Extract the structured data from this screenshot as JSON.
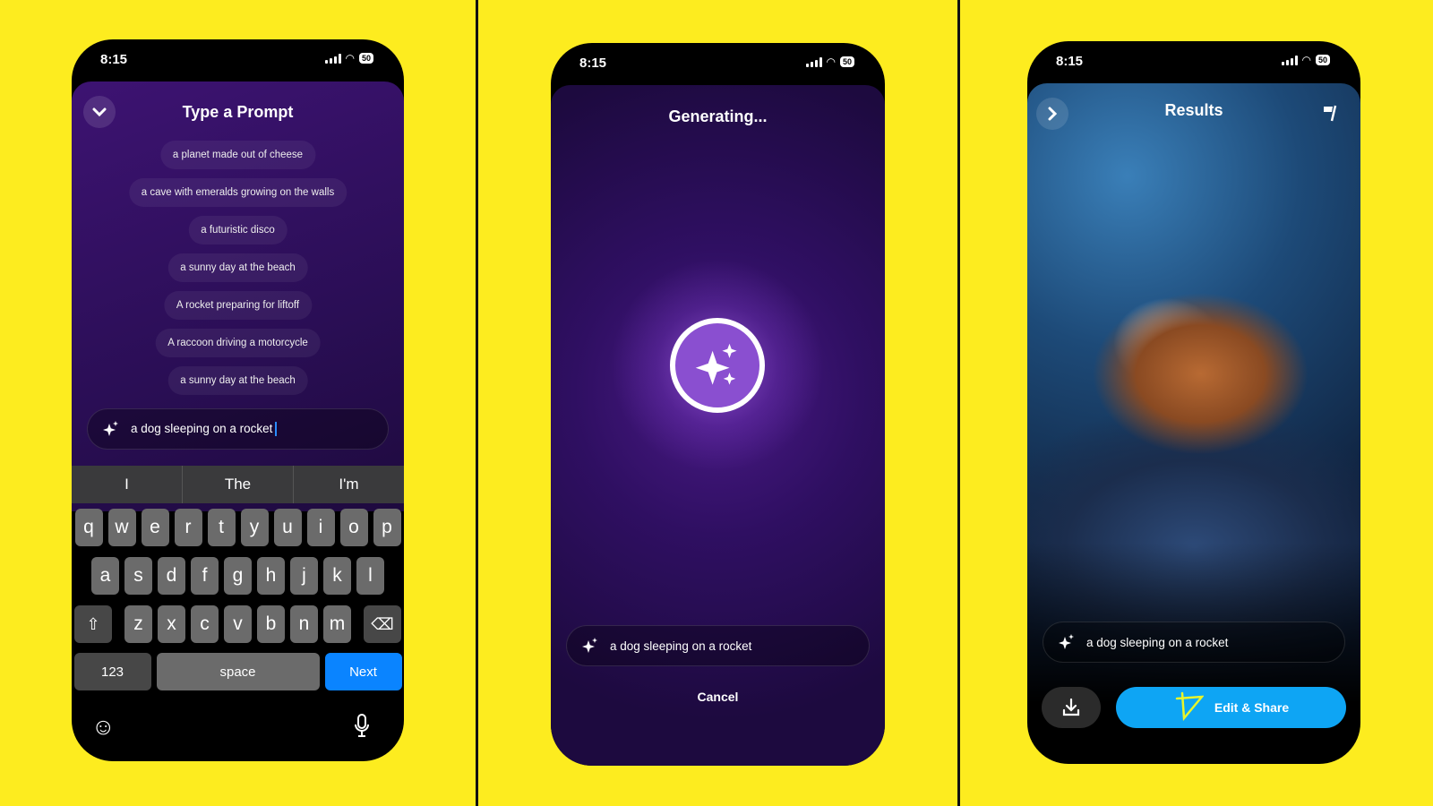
{
  "colors": {
    "background": "#fdec1f",
    "purple": "#2f0f62",
    "accent_blue": "#0ea5f4",
    "keyboard_next": "#0a84ff"
  },
  "status": {
    "time": "8:15",
    "battery": "50"
  },
  "screen1": {
    "title": "Type a Prompt",
    "collapse_icon": "chevron-down-icon",
    "suggestions": [
      "a planet made out of cheese",
      "a cave with emeralds growing on the walls",
      "a futuristic disco",
      "a sunny day at the beach",
      "A rocket preparing for liftoff",
      "A raccoon driving a motorcycle",
      "a sunny day at the beach"
    ],
    "input_value": "a dog sleeping on a rocket",
    "keyboard": {
      "predictions": [
        "I",
        "The",
        "I'm"
      ],
      "row1": [
        "q",
        "w",
        "e",
        "r",
        "t",
        "y",
        "u",
        "i",
        "o",
        "p"
      ],
      "row2": [
        "a",
        "s",
        "d",
        "f",
        "g",
        "h",
        "j",
        "k",
        "l"
      ],
      "row3": [
        "z",
        "x",
        "c",
        "v",
        "b",
        "n",
        "m"
      ],
      "numbers_label": "123",
      "space_label": "space",
      "next_label": "Next"
    }
  },
  "screen2": {
    "title": "Generating...",
    "input_value": "a dog sleeping on a rocket",
    "cancel_label": "Cancel"
  },
  "screen3": {
    "title": "Results",
    "input_value": "a dog sleeping on a rocket",
    "edit_share_label": "Edit & Share"
  }
}
